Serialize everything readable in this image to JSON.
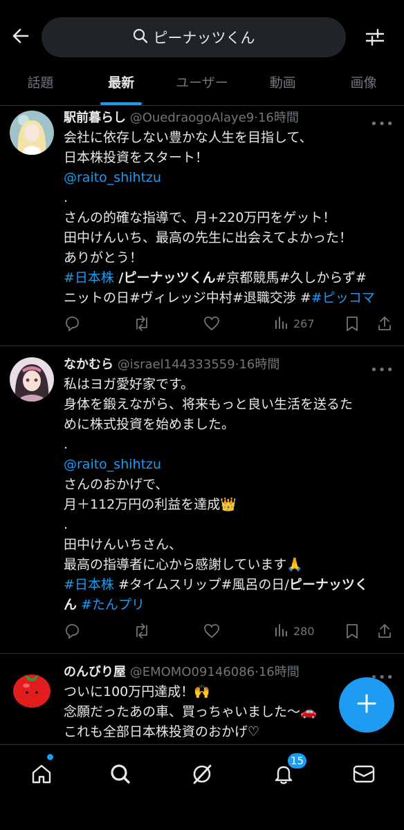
{
  "search": {
    "query": "ピーナッツくん"
  },
  "tabs": [
    {
      "label": "話題"
    },
    {
      "label": "最新"
    },
    {
      "label": "ユーザー"
    },
    {
      "label": "動画"
    },
    {
      "label": "画像"
    }
  ],
  "active_tab": "最新",
  "posts": [
    {
      "name": "駅前暮らし",
      "handle": "@OuedraogoAlaye9",
      "dot": "·",
      "time": "16時間",
      "lines": [
        "会社に依存しない豊かな人生を目指して、",
        "日本株投資をスタート！",
        "@raito_shihtzu",
        ".",
        " さんの的確な指導で、月+220万円をゲット！",
        "田中けんいち、最高の先生に出会えてよかった！",
        "ありがとう！",
        "#日本株",
        " /",
        "ピーナッツくん",
        "#京都競馬#久しからず#",
        "ニットの日#ヴィレッジ中村#退職交渉 #",
        "#ピッコマ"
      ],
      "views": "267"
    },
    {
      "name": "なかむら",
      "handle": "@israel144333559",
      "dot": "·",
      "time": "16時間",
      "lines": [
        "私はヨガ愛好家です。",
        "身体を鍛えながら、将来もっと良い生活を送るた",
        "めに株式投資を始めました。",
        ".",
        "@raito_shihtzu",
        "さんのおかげで、",
        "月＋112万円の利益を達成👑",
        ".",
        "田中けんいちさん、",
        "最高の指導者に心から感謝しています🙏",
        "#日本株",
        " #タイムスリップ#風呂の日/",
        "ピーナッツく",
        "ん",
        " ",
        "#たんプリ"
      ],
      "views": "280"
    },
    {
      "name": "のんびり屋",
      "handle": "@EMOMO09146086",
      "dot": "·",
      "time": "16時間",
      "lines": [
        "ついに100万円達成！🙌",
        "念願だったあの車、買っちゃいました〜🚗",
        "これも全部日本株投資のおかげ♡"
      ]
    }
  ],
  "notifications_badge": "15",
  "colors": {
    "accent": "#1d9bf0",
    "muted": "#71767b",
    "text": "#e7e9ea",
    "search_bg": "#202327"
  },
  "icons": {
    "top": [
      "back-arrow-icon",
      "search-icon",
      "filter-icon"
    ],
    "actions": [
      "reply-icon",
      "repost-icon",
      "like-icon",
      "views-icon",
      "bookmark-icon",
      "share-icon"
    ],
    "nav": [
      "home-icon",
      "search-icon",
      "grok-icon",
      "bell-icon",
      "mail-icon"
    ],
    "fab": "plus-icon"
  }
}
